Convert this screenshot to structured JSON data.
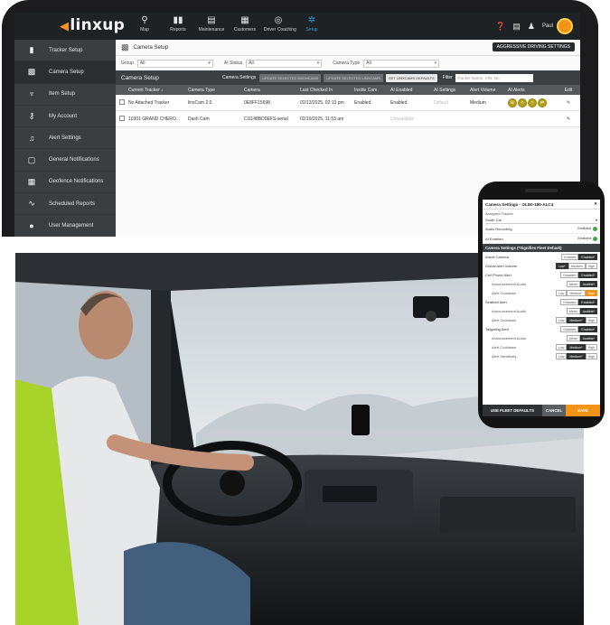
{
  "app": {
    "logo": "linxup",
    "nav": [
      {
        "label": "Map",
        "icon": "map-icon",
        "glyph": "⚲"
      },
      {
        "label": "Reports",
        "icon": "reports-icon",
        "glyph": "▮▮"
      },
      {
        "label": "Maintenance",
        "icon": "maintenance-icon",
        "glyph": "▤"
      },
      {
        "label": "Customers",
        "icon": "customers-icon",
        "glyph": "▦"
      },
      {
        "label": "Driver Coaching",
        "icon": "driver-coaching-icon",
        "glyph": "◎"
      },
      {
        "label": "Setup",
        "icon": "setup-gear-icon",
        "glyph": "✲"
      }
    ],
    "user_name": "Paul",
    "colors": {
      "accent": "#2f9bd6",
      "brand_orange": "#f29418",
      "dark": "#1e2224"
    }
  },
  "sidebar": {
    "items": [
      {
        "label": "Tracker Setup",
        "icon": "tracker-icon",
        "glyph": "▮"
      },
      {
        "label": "Camera Setup",
        "icon": "camera-setup-icon",
        "glyph": "▩"
      },
      {
        "label": "Item Setup",
        "icon": "item-icon",
        "glyph": "♆"
      },
      {
        "label": "My Account",
        "icon": "account-icon",
        "glyph": "⚷"
      },
      {
        "label": "Alert Settings",
        "icon": "bell-icon",
        "glyph": "♫"
      },
      {
        "label": "General Notifications",
        "icon": "notifications-icon",
        "glyph": "▢"
      },
      {
        "label": "Geofence Notifications",
        "icon": "geofence-icon",
        "glyph": "▦"
      },
      {
        "label": "Scheduled Reports",
        "icon": "scheduled-reports-icon",
        "glyph": "∿"
      },
      {
        "label": "User Management",
        "icon": "user-management-icon",
        "glyph": "●"
      }
    ]
  },
  "page": {
    "title": "Camera Setup",
    "aggressive_button": "AGGRESSIVE DRIVING SETTINGS",
    "filters": [
      {
        "label": "Group",
        "value": "All"
      },
      {
        "label": "AI Status",
        "value": "All"
      },
      {
        "label": "Camera Type",
        "value": "All"
      }
    ],
    "table_title": "Camera Setup",
    "camera_settings_label": "Camera Settings",
    "buttons": [
      "UPDATE SELECTED DASHCAMS",
      "UPDATE SELECTED LINXCAMS",
      "SET LINXCAMS DEFAULTS"
    ],
    "filter_label": "Filter",
    "filter_placeholder": "Tracker Name, VIN, etc.",
    "columns": [
      "Current Tracker ↓",
      "Camera Type",
      "Camera",
      "Last Checked In",
      "Inside Cam",
      "AI Enabled",
      "AI Settings",
      "Alert Volume",
      "AI Alerts",
      "Edit"
    ],
    "rows": [
      {
        "tracker": "No Attached Tracker",
        "type": "linxCam 2.0",
        "camera": "0E8FF15698",
        "checked": "02/13/2025, 02:13 pm",
        "inside": "Enabled",
        "ai_enabled": "Enabled",
        "ai_settings": "Default",
        "volume": "Medium",
        "edit": "✎"
      },
      {
        "tracker": "10301 GRAND CHERO...",
        "type": "Dash Cam",
        "camera": "CI1148BD0EFS-serial",
        "checked": "02/19/2025, 11:53 am",
        "inside": "",
        "ai_enabled": "Unavailable",
        "ai_settings": "",
        "volume": "",
        "edit": "✎"
      }
    ]
  },
  "phone": {
    "title": "Camera Settings - OLD0-180-ALC4",
    "assigned_label": "Assigned Tracker",
    "assigned_value": "South Car",
    "audio_recording": {
      "label": "Audio Recording",
      "value": "Enabled"
    },
    "ai_enabled": {
      "label": "AI Enabled",
      "value": "Enabled"
    },
    "section": "Camera Settings (*Signifies Fleet Default)",
    "settings": [
      {
        "label": "Inside Camera",
        "sub": false,
        "options": [
          "Enabled",
          "Enabled*"
        ],
        "selected": 1,
        "style": "on"
      },
      {
        "label": "Global Alert Volume",
        "sub": false,
        "options": [
          "Low*",
          "Medium",
          "High"
        ],
        "selected": 0,
        "style": "on"
      },
      {
        "label": "Cell Phone Alert",
        "sub": false,
        "options": [
          "Disabled",
          "Enabled*"
        ],
        "selected": 1,
        "style": "on"
      },
      {
        "label": "Announcement Audio",
        "sub": true,
        "options": [
          "Metal",
          "Audible*"
        ],
        "selected": 1,
        "style": "on"
      },
      {
        "label": "Alert Cooldown",
        "sub": true,
        "options": [
          "Low",
          "Medium*",
          "High"
        ],
        "selected": 2,
        "style": "orange"
      },
      {
        "label": "Seatbelt Alert",
        "sub": false,
        "options": [
          "Disabled",
          "Enabled*"
        ],
        "selected": 1,
        "style": "on"
      },
      {
        "label": "Announcement Audio",
        "sub": true,
        "options": [
          "Metal",
          "Audible*"
        ],
        "selected": 1,
        "style": "on"
      },
      {
        "label": "Alert Cooldown",
        "sub": true,
        "options": [
          "Low",
          "Medium*",
          "High"
        ],
        "selected": 1,
        "style": "on"
      },
      {
        "label": "Tailgating Alert",
        "sub": false,
        "options": [
          "Disabled",
          "Enabled*"
        ],
        "selected": 1,
        "style": "on"
      },
      {
        "label": "Announcement Audio",
        "sub": true,
        "options": [
          "Metal",
          "Audible*"
        ],
        "selected": 1,
        "style": "on"
      },
      {
        "label": "Alert Cooldown",
        "sub": true,
        "options": [
          "Low",
          "Medium*",
          "High"
        ],
        "selected": 1,
        "style": "on"
      },
      {
        "label": "Alert Sensitivity",
        "sub": true,
        "options": [
          "Low",
          "Medium*",
          "High"
        ],
        "selected": 1,
        "style": "on"
      }
    ],
    "footer": {
      "defaults": "USE FLEET DEFAULTS",
      "cancel": "CANCEL",
      "save": "SAVE"
    }
  }
}
